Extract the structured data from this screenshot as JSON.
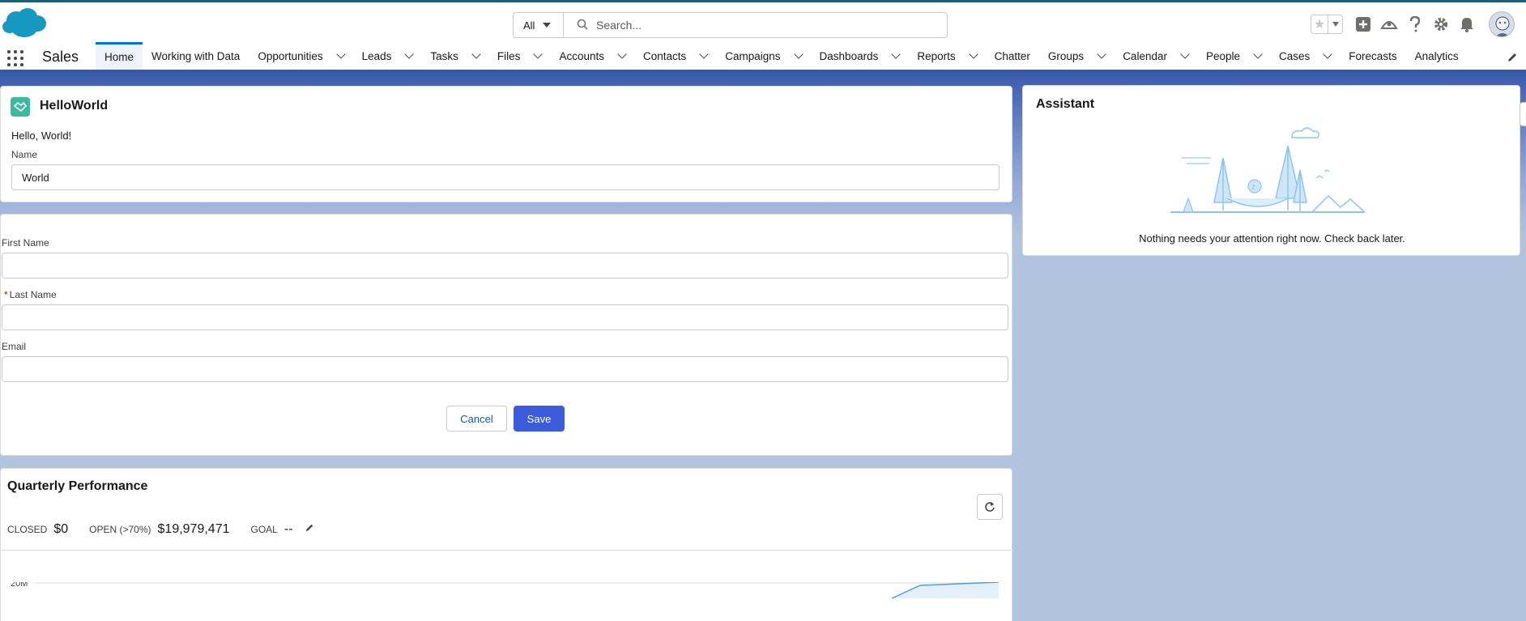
{
  "header": {
    "search_scope": "All",
    "search_placeholder": "Search..."
  },
  "nav": {
    "app_name": "Sales",
    "items": [
      {
        "label": "Home",
        "active": true,
        "dropdown": false
      },
      {
        "label": "Working with Data",
        "active": false,
        "dropdown": false
      },
      {
        "label": "Opportunities",
        "active": false,
        "dropdown": true
      },
      {
        "label": "Leads",
        "active": false,
        "dropdown": true
      },
      {
        "label": "Tasks",
        "active": false,
        "dropdown": true
      },
      {
        "label": "Files",
        "active": false,
        "dropdown": true
      },
      {
        "label": "Accounts",
        "active": false,
        "dropdown": true
      },
      {
        "label": "Contacts",
        "active": false,
        "dropdown": true
      },
      {
        "label": "Campaigns",
        "active": false,
        "dropdown": true
      },
      {
        "label": "Dashboards",
        "active": false,
        "dropdown": true
      },
      {
        "label": "Reports",
        "active": false,
        "dropdown": true
      },
      {
        "label": "Chatter",
        "active": false,
        "dropdown": false
      },
      {
        "label": "Groups",
        "active": false,
        "dropdown": true
      },
      {
        "label": "Calendar",
        "active": false,
        "dropdown": true
      },
      {
        "label": "People",
        "active": false,
        "dropdown": true
      },
      {
        "label": "Cases",
        "active": false,
        "dropdown": true
      },
      {
        "label": "Forecasts",
        "active": false,
        "dropdown": false
      },
      {
        "label": "Analytics",
        "active": false,
        "dropdown": false
      }
    ]
  },
  "hello_world": {
    "title": "HelloWorld",
    "greeting": "Hello, World!",
    "name_label": "Name",
    "name_value": "World"
  },
  "form": {
    "first_name_label": "First Name",
    "first_name_value": "",
    "last_name_required": "*",
    "last_name_label": "Last Name",
    "last_name_value": "",
    "email_label": "Email",
    "email_value": "",
    "cancel_label": "Cancel",
    "save_label": "Save"
  },
  "performance": {
    "title": "Quarterly Performance",
    "closed_label": "CLOSED",
    "closed_value": "$0",
    "open_label": "OPEN (>70%)",
    "open_value": "$19,979,471",
    "goal_label": "GOAL",
    "goal_value": "--",
    "y_tick": "20M"
  },
  "assistant": {
    "title": "Assistant",
    "message": "Nothing needs your attention right now. Check back later."
  },
  "colors": {
    "brand_blue": "#0176d3",
    "save_button": "#3b5bdb",
    "helloworld_icon": "#3bba9f",
    "chart_line": "#4a9fd8"
  }
}
